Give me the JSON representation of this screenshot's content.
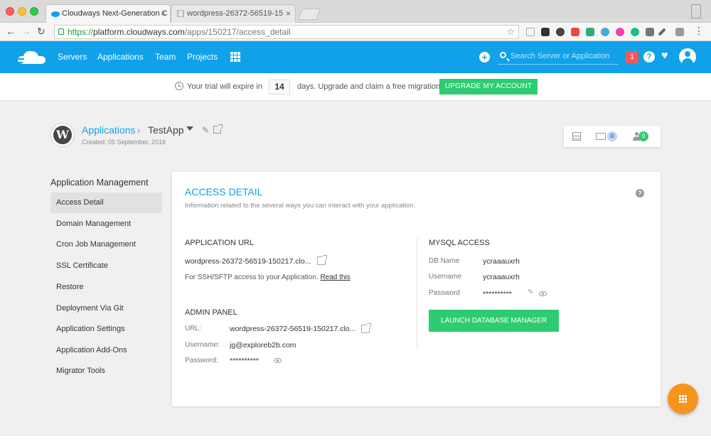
{
  "browser": {
    "tabs": [
      {
        "label": "Cloudways Next-Generation C"
      },
      {
        "label": "wordpress-26372-56519-15"
      }
    ],
    "url": {
      "scheme": "https://",
      "host": "platform.cloudways.com",
      "path": "/apps/150217/access_detail"
    }
  },
  "header": {
    "nav": [
      "Servers",
      "Applications",
      "Team",
      "Projects"
    ],
    "search_placeholder": "Search Server or Application",
    "notification_count": "1",
    "accent_color": "#10a1e8"
  },
  "trial": {
    "text_before": "Your trial will expire in",
    "days": "14",
    "text_after": "days. Upgrade and claim a free migration",
    "upgrade_label": "UPGRADE MY ACCOUNT"
  },
  "breadcrumb": {
    "parent": "Applications",
    "current": "TestApp",
    "created": "Created: 05 September, 2016"
  },
  "summary": {
    "folders_count": "0",
    "users_count": "0"
  },
  "sidebar": {
    "title": "Application Management",
    "items": [
      "Access Detail",
      "Domain Management",
      "Cron Job Management",
      "SSL Certificate",
      "Restore",
      "Deployment Via Git",
      "Application Settings",
      "Application Add-Ons",
      "Migrator Tools"
    ],
    "active_index": 0
  },
  "access": {
    "title": "ACCESS DETAIL",
    "subtitle": "Information related to the several ways you can interact with your application.",
    "app_url_title": "APPLICATION URL",
    "app_url_value": "wordpress-26372-56519-150217.clo...",
    "ssh_note": "For SSH/SFTP access to your Application.",
    "read_link": "Read this",
    "admin_title": "ADMIN PANEL",
    "admin_url_label": "URL:",
    "admin_url_value": "wordpress-26372-56519-150217.clo...",
    "admin_user_label": "Username:",
    "admin_user_value": "jg@exploreb2b.com",
    "admin_pass_label": "Password:",
    "admin_pass_value": "**********",
    "mysql_title": "MYSQL ACCESS",
    "db_name_label": "DB Name",
    "db_name_value": "ycraaauxrh",
    "db_user_label": "Username",
    "db_user_value": "ycraaauxrh",
    "db_pass_label": "Password",
    "db_pass_value": "**********",
    "launch_label": "LAUNCH DATABASE MANAGER"
  }
}
